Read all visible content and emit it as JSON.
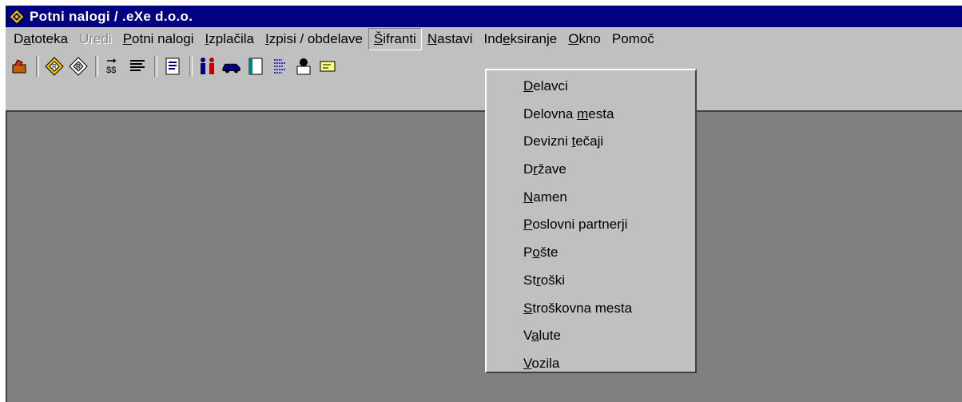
{
  "window": {
    "title": "Potni nalogi / .eXe d.o.o."
  },
  "menubar": {
    "items": [
      {
        "pre": "D",
        "u": "a",
        "post": "toteka",
        "state": "normal"
      },
      {
        "pre": "",
        "u": "",
        "post": "Uredi",
        "state": "disabled"
      },
      {
        "pre": "",
        "u": "P",
        "post": "otni nalogi",
        "state": "normal"
      },
      {
        "pre": "",
        "u": "I",
        "post": "zplačila",
        "state": "normal"
      },
      {
        "pre": "",
        "u": "I",
        "post": "zpisi / obdelave",
        "state": "normal"
      },
      {
        "pre": "",
        "u": "Š",
        "post": "ifranti",
        "state": "active"
      },
      {
        "pre": "",
        "u": "N",
        "post": "astavi",
        "state": "normal"
      },
      {
        "pre": "Ind",
        "u": "e",
        "post": "ksiranje",
        "state": "normal"
      },
      {
        "pre": "",
        "u": "O",
        "post": "kno",
        "state": "normal"
      },
      {
        "pre": "",
        "u": "",
        "post": "Pomoč",
        "state": "normal"
      }
    ]
  },
  "toolbar": {
    "icons": [
      "open-icon",
      "sep",
      "travel-order-icon",
      "travel-order-edit-icon",
      "sep",
      "transfer-icon",
      "list-icon",
      "sep",
      "document-icon",
      "sep",
      "people-icon",
      "car-icon",
      "book-icon",
      "text-list-icon",
      "user-card-icon",
      "card-icon"
    ]
  },
  "dropdown": {
    "items": [
      {
        "pre": "",
        "u": "D",
        "post": "elavci"
      },
      {
        "pre": "Delovna ",
        "u": "m",
        "post": "esta"
      },
      {
        "pre": "Devizni ",
        "u": "t",
        "post": "ečaji"
      },
      {
        "pre": "D",
        "u": "r",
        "post": "žave"
      },
      {
        "pre": "",
        "u": "N",
        "post": "amen"
      },
      {
        "pre": "",
        "u": "P",
        "post": "oslovni partnerji"
      },
      {
        "pre": "P",
        "u": "o",
        "post": "šte"
      },
      {
        "pre": "St",
        "u": "r",
        "post": "oški"
      },
      {
        "pre": "",
        "u": "S",
        "post": "troškovna mesta"
      },
      {
        "pre": "V",
        "u": "a",
        "post": "lute"
      },
      {
        "pre": "",
        "u": "V",
        "post": "ozila"
      }
    ]
  },
  "colors": {
    "titlebar": "#000080",
    "face": "#c0c0c0",
    "workspace": "#808080",
    "disabled_text": "#8a8a8a"
  }
}
